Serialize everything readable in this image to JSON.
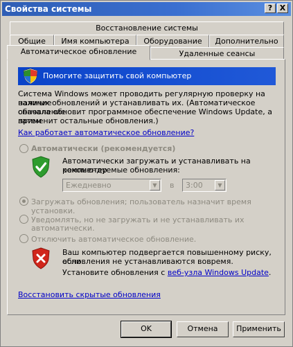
{
  "window": {
    "title": "Свойства системы"
  },
  "titlebar_buttons": {
    "help": "?",
    "close": "X"
  },
  "tabs": {
    "row1": [
      "Восстановление системы"
    ],
    "row2": [
      "Общие",
      "Имя компьютера",
      "Оборудование",
      "Дополнительно"
    ],
    "row3": [
      "Автоматическое обновление",
      "Удаленные сеансы"
    ]
  },
  "banner": {
    "text": "Помогите защитить свой компьютер"
  },
  "intro": {
    "line1": "Система Windows может проводить регулярную проверку на наличие",
    "line2": "важных обновлений и устанавливать их. (Автоматическое обновление",
    "line3": "сначала обновит программное обеспечение Windows Update, а затем",
    "line4": "применит остальные обновления.)"
  },
  "how_link": "Как работает автоматическое обновление?",
  "options": {
    "auto": {
      "label": "Автоматически (рекомендуется)",
      "desc1": "Автоматически загружать и устанавливать на компьютер",
      "desc2": "рекомендуемые обновления:",
      "day": "Ежедневно",
      "at": "в",
      "time": "3:00"
    },
    "download": "Загружать обновления; пользователь назначит время установки.",
    "notify1": "Уведомлять, но не загружать и не устанавливать их",
    "notify2": "автоматически.",
    "off": "Отключить автоматическое обновление."
  },
  "risk": {
    "line1": "Ваш компьютер подвергается повышенному риску, если",
    "line2": "обновления не устанавливаются вовремя.",
    "line3_prefix": "Установите обновления с ",
    "line3_link": "веб-узла Windows Update",
    "line3_suffix": "."
  },
  "restore_link": "Восстановить скрытые обновления",
  "buttons": {
    "ok": "OK",
    "cancel": "Отмена",
    "apply": "Применить"
  }
}
